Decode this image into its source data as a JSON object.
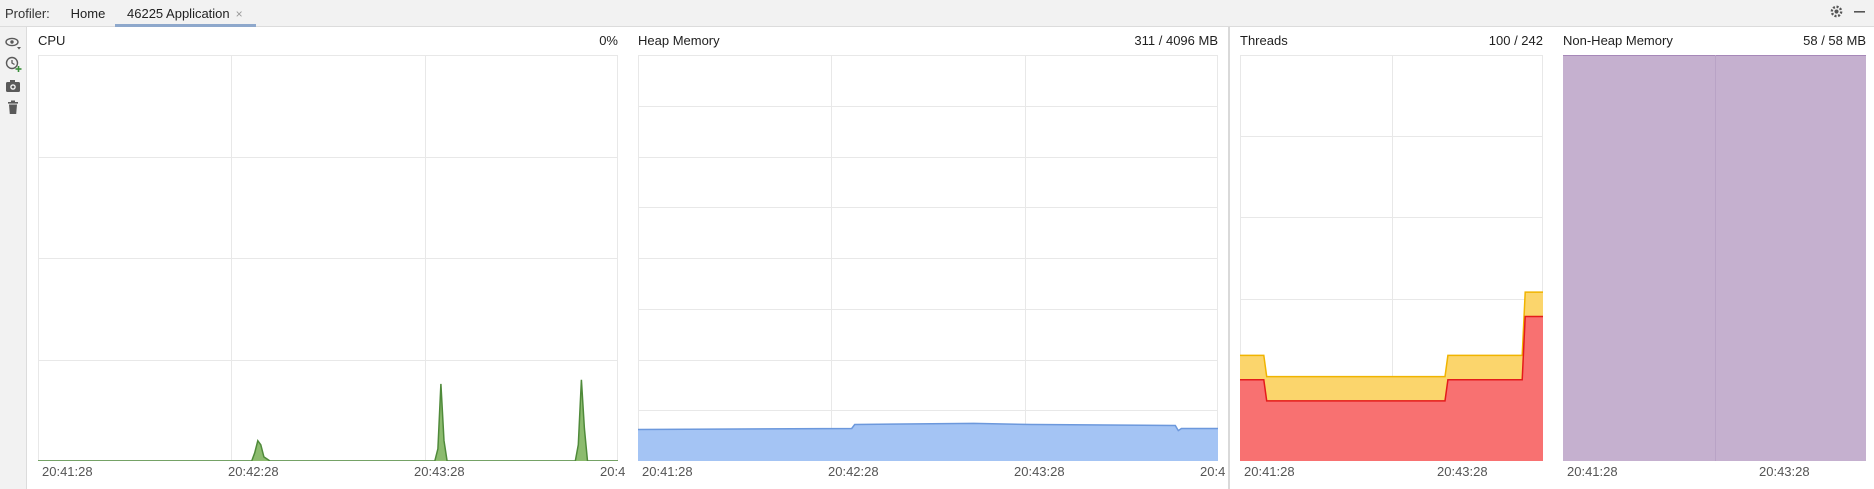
{
  "header": {
    "profiler_label": "Profiler:",
    "tabs": [
      {
        "label": "Home"
      },
      {
        "label": "46225 Application",
        "close": "×"
      }
    ],
    "settings_icon": "gear-icon",
    "minimize_icon": "minimize-icon"
  },
  "toolbar": {
    "icons": [
      "eye-dropdown-icon",
      "add-profile-icon",
      "camera-snapshot-icon",
      "trash-icon"
    ]
  },
  "panels": {
    "cpu": {
      "title": "CPU",
      "value": "0%",
      "ticks": [
        "20:41:28",
        "20:42:28",
        "20:43:28",
        "20:4"
      ]
    },
    "heap": {
      "title": "Heap Memory",
      "value": "311 / 4096 MB",
      "ticks": [
        "20:41:28",
        "20:42:28",
        "20:43:28",
        "20:4"
      ]
    },
    "threads": {
      "title": "Threads",
      "value": "100 / 242",
      "ticks": [
        "20:41:28",
        "20:43:28"
      ]
    },
    "nonheap": {
      "title": "Non-Heap Memory",
      "value": "58 / 58 MB",
      "ticks": [
        "20:41:28",
        "20:43:28"
      ]
    }
  },
  "colors": {
    "cpu_fill": "#8cbb6e",
    "cpu_line": "#4f8a3a",
    "heap_fill": "#a4c4f4",
    "heap_line": "#6c98dc",
    "threads_total_fill": "#fbd56c",
    "threads_total_line": "#f0b400",
    "threads_live_fill": "#f87171",
    "threads_live_line": "#e41b1b",
    "nonheap_fill": "#c5b0cf",
    "nonheap_line": "#9c7bb0",
    "grid": "#e8e8e8"
  },
  "chart_data": [
    {
      "type": "area",
      "name": "CPU",
      "x_unit": "seconds",
      "xlim": [
        0,
        190
      ],
      "ylim": [
        0,
        100
      ],
      "series": [
        {
          "x": [
            0,
            70,
            71,
            72,
            73,
            74,
            76,
            130,
            131,
            132,
            133,
            134,
            176,
            177,
            178,
            179,
            180,
            190
          ],
          "y": [
            0,
            0,
            2,
            5,
            4,
            1,
            0,
            0,
            3,
            19,
            5,
            0,
            0,
            4,
            20,
            8,
            0,
            0
          ]
        }
      ]
    },
    {
      "type": "area",
      "name": "Heap Memory",
      "x_unit": "seconds",
      "xlim": [
        0,
        190
      ],
      "ylim": [
        0,
        400
      ],
      "series": [
        {
          "x": [
            0,
            70,
            71,
            110,
            129,
            130,
            176,
            177,
            178,
            190
          ],
          "y": [
            31,
            32,
            36,
            37,
            36,
            36,
            35,
            30,
            32,
            32
          ]
        }
      ]
    },
    {
      "type": "area",
      "name": "Threads",
      "x_unit": "seconds",
      "xlim": [
        0,
        102
      ],
      "ylim": [
        0,
        250
      ],
      "series": [
        {
          "x": [
            0,
            8,
            9,
            69,
            70,
            95,
            96,
            102
          ],
          "y": [
            65,
            65,
            52,
            52,
            65,
            65,
            104,
            104
          ]
        },
        {
          "x": [
            0,
            8,
            9,
            69,
            70,
            95,
            96,
            102
          ],
          "y": [
            50,
            50,
            37,
            37,
            50,
            50,
            89,
            89
          ]
        }
      ]
    },
    {
      "type": "area",
      "name": "Non-Heap Memory",
      "x_unit": "seconds",
      "xlim": [
        0,
        102
      ],
      "ylim": [
        0,
        58
      ],
      "series": [
        {
          "x": [
            0,
            102
          ],
          "y": [
            58,
            58
          ]
        }
      ]
    }
  ]
}
